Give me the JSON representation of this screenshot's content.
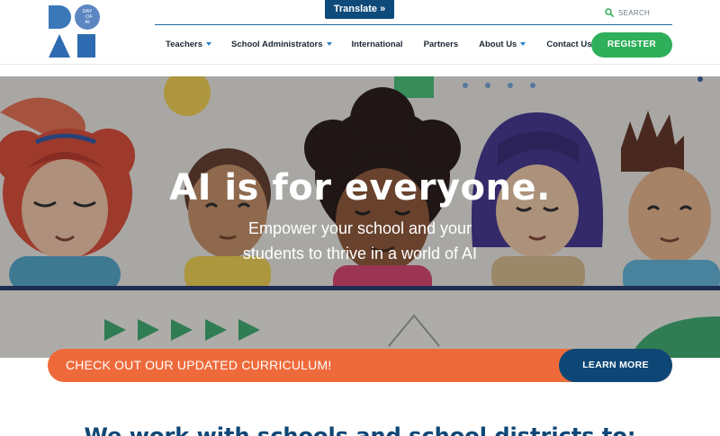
{
  "header": {
    "logo": {
      "alt": "Day of AI",
      "badge_lines": [
        "DAY",
        "OF",
        "AI"
      ]
    },
    "translate_label": "Translate »",
    "search": {
      "icon": "search-icon",
      "placeholder": "SEARCH"
    },
    "nav": [
      {
        "label": "Teachers",
        "has_dropdown": true
      },
      {
        "label": "School Administrators",
        "has_dropdown": true
      },
      {
        "label": "International",
        "has_dropdown": false
      },
      {
        "label": "Partners",
        "has_dropdown": false
      },
      {
        "label": "About Us",
        "has_dropdown": true
      },
      {
        "label": "Contact Us",
        "has_dropdown": false
      }
    ],
    "register_label": "REGISTER"
  },
  "hero": {
    "title": "AI is for everyone.",
    "subtitle": "Empower your school and your students to thrive in a world of AI"
  },
  "banner": {
    "text": "CHECK OUT OUR UPDATED CURRICULUM!",
    "button_label": "LEARN MORE"
  },
  "section": {
    "heading": "We work with schools and school districts to:"
  },
  "colors": {
    "brand_blue": "#0e4776",
    "accent_green": "#2eaf5a",
    "banner_orange": "#ef6a3b",
    "nav_caret": "#2d7fc4"
  }
}
